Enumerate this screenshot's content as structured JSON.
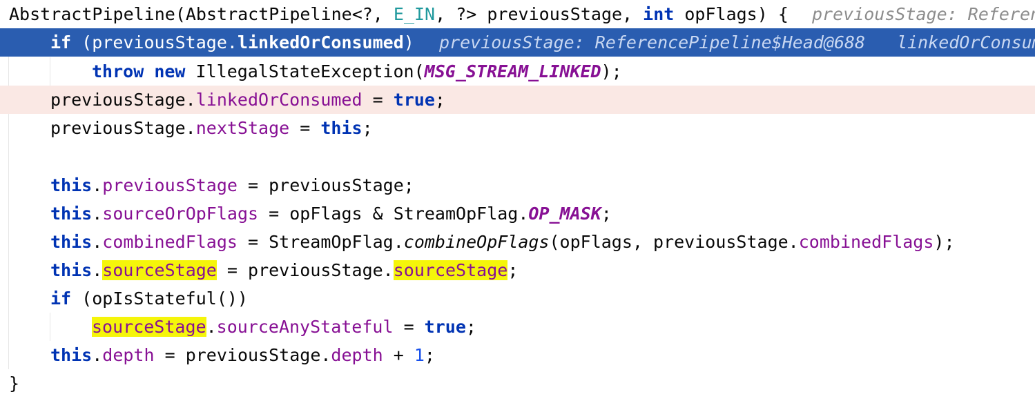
{
  "editor": {
    "lines": {
      "l1": {
        "t1": "AbstractPipeline(AbstractPipeline<?, ",
        "t2": "E_IN",
        "t3": ", ?> previousStage, ",
        "t4": "int",
        "t5": " opFlags) {",
        "hint": "previousStage: Referen"
      },
      "l2": {
        "t1": "if",
        "t2": " (previousStage.",
        "t3": "linkedOrConsumed",
        "t4": ")",
        "hint1": "previousStage: ReferencePipeline$Head@688",
        "hint2": "linkedOrConsumed"
      },
      "l3": {
        "t1": "throw",
        "t2": " ",
        "t3": "new",
        "t4": " IllegalStateException(",
        "t5": "MSG_STREAM_LINKED",
        "t6": ");"
      },
      "l4": {
        "t1": "previousStage.",
        "t2": "linkedOrConsumed",
        "t3": " = ",
        "t4": "true",
        "t5": ";"
      },
      "l5": {
        "t1": "previousStage.",
        "t2": "nextStage",
        "t3": " = ",
        "t4": "this",
        "t5": ";"
      },
      "l7": {
        "t1": "this",
        "t2": ".",
        "t3": "previousStage",
        "t4": " = previousStage;"
      },
      "l8": {
        "t1": "this",
        "t2": ".",
        "t3": "sourceOrOpFlags",
        "t4": " = opFlags & StreamOpFlag.",
        "t5": "OP_MASK",
        "t6": ";"
      },
      "l9": {
        "t1": "this",
        "t2": ".",
        "t3": "combinedFlags",
        "t4": " = StreamOpFlag.",
        "t5": "combineOpFlags",
        "t6": "(opFlags, previousStage.",
        "t7": "combinedFlags",
        "t8": ");"
      },
      "l10": {
        "t1": "this",
        "t2": ".",
        "t3": "sourceStage",
        "t4": " = previousStage.",
        "t5": "sourceStage",
        "t6": ";"
      },
      "l11": {
        "t1": "if",
        "t2": " (opIsStateful())"
      },
      "l12": {
        "t1": "sourceStage",
        "t2": ".",
        "t3": "sourceAnyStateful",
        "t4": " = ",
        "t5": "true",
        "t6": ";"
      },
      "l13": {
        "t1": "this",
        "t2": ".",
        "t3": "depth",
        "t4": " = previousStage.",
        "t5": "depth",
        "t6": " + ",
        "t7": "1",
        "t8": ";"
      },
      "l14": {
        "t1": "}"
      }
    }
  }
}
